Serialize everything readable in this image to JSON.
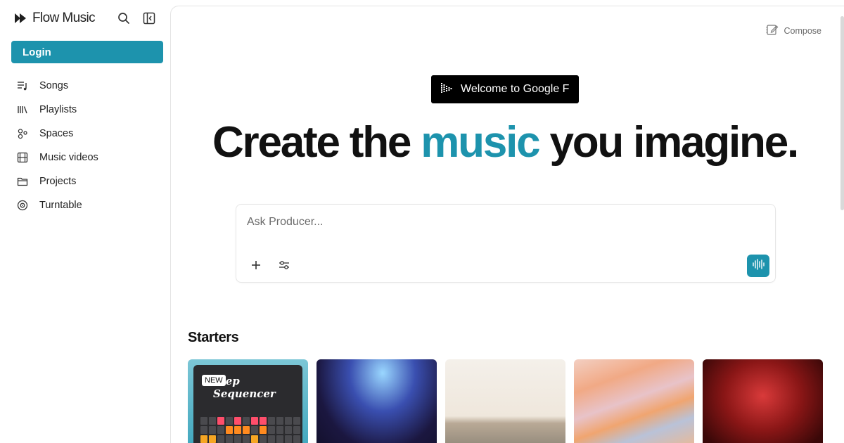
{
  "app": {
    "name": "Flow Music",
    "accent_color": "#1d93ad"
  },
  "sidebar": {
    "login_label": "Login",
    "items": [
      {
        "label": "Songs",
        "icon": "songs-list-icon"
      },
      {
        "label": "Playlists",
        "icon": "library-icon"
      },
      {
        "label": "Spaces",
        "icon": "spaces-icon"
      },
      {
        "label": "Music videos",
        "icon": "film-icon"
      },
      {
        "label": "Projects",
        "icon": "folder-icon"
      },
      {
        "label": "Turntable",
        "icon": "vinyl-icon"
      }
    ]
  },
  "header": {
    "compose_label": "Compose"
  },
  "main": {
    "welcome_label": "Welcome to Google F",
    "hero": {
      "before": "Create the ",
      "accent": "music",
      "after": " you imagine."
    },
    "prompt": {
      "placeholder": "Ask Producer..."
    },
    "starters_title": "Starters",
    "starters": [
      {
        "badge": "NEW",
        "title": "Step Sequencer"
      },
      {
        "badge": "",
        "title": ""
      },
      {
        "badge": "",
        "title": ""
      },
      {
        "badge": "",
        "title": ""
      },
      {
        "badge": "",
        "title": ""
      }
    ]
  }
}
